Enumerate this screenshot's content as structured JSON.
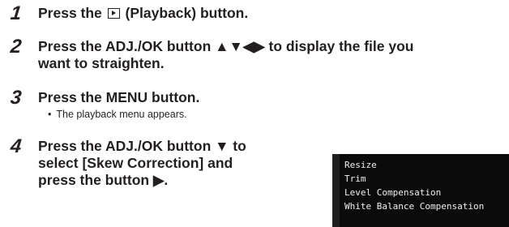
{
  "steps": [
    {
      "num": "1",
      "before": "Press the",
      "icon": "playback-icon",
      "after": "(Playback) button."
    },
    {
      "num": "2",
      "line1": "Press the ADJ./OK button ▲▼◀▶ to display the file you",
      "line2": "want to straighten."
    },
    {
      "num": "3",
      "line1": "Press the MENU button.",
      "sub_bullet": "•",
      "sub": "The playback menu appears."
    },
    {
      "num": "4",
      "line1": "Press the ADJ./OK button ▼ to",
      "line2": "select [Skew Correction] and",
      "line3": "press the button ▶."
    }
  ],
  "menu": {
    "items": [
      "Resize",
      "Trim",
      "Level Compensation",
      "White Balance Compensation"
    ]
  }
}
